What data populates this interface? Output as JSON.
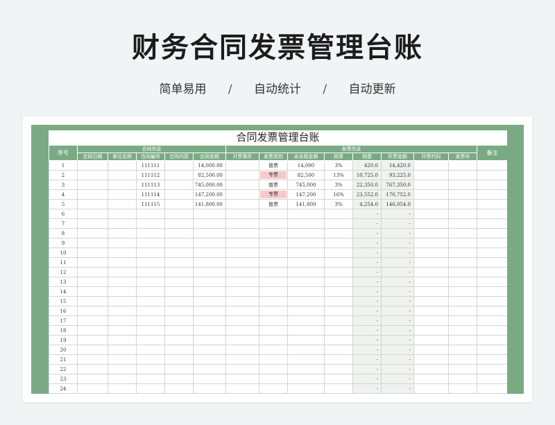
{
  "page": {
    "title": "财务合同发票管理台账",
    "tags": [
      "简单易用",
      "自动统计",
      "自动更新"
    ],
    "separator": "/"
  },
  "sheet": {
    "title": "合同发票管理台账",
    "headers": {
      "index": "序号",
      "contract_group": "合同信息",
      "invoice_group": "发票信息",
      "remark": "备注",
      "contract_cols": [
        "合同日期",
        "单位名称",
        "合同编号",
        "合同内容",
        "合同金额"
      ],
      "invoice_cols": [
        "开票事件",
        "发票类别",
        "未含税金额",
        "税率",
        "税费",
        "开票金额",
        "开票代码",
        "发票号"
      ]
    },
    "rows": [
      {
        "index": "1",
        "contract_no": "111111",
        "contract_amount": "14,000.00",
        "invoice_type": "普票",
        "untaxed": "14,000",
        "rate": "3%",
        "tax": "420.0",
        "invoice_amount": "14,420.0"
      },
      {
        "index": "2",
        "contract_no": "111112",
        "contract_amount": "82,500.00",
        "invoice_type": "专票",
        "untaxed": "82,500",
        "rate": "13%",
        "tax": "10,725.0",
        "invoice_amount": "93,225.0"
      },
      {
        "index": "3",
        "contract_no": "111113",
        "contract_amount": "745,000.00",
        "invoice_type": "普票",
        "untaxed": "745,000",
        "rate": "3%",
        "tax": "22,350.0",
        "invoice_amount": "767,350.0"
      },
      {
        "index": "4",
        "contract_no": "111114",
        "contract_amount": "147,200.00",
        "invoice_type": "专票",
        "untaxed": "147,200",
        "rate": "16%",
        "tax": "23,552.0",
        "invoice_amount": "170,752.0"
      },
      {
        "index": "5",
        "contract_no": "111115",
        "contract_amount": "141,800.00",
        "invoice_type": "普票",
        "untaxed": "141,800",
        "rate": "3%",
        "tax": "4,254.0",
        "invoice_amount": "146,054.0"
      }
    ],
    "empty_row_indices": [
      "6",
      "7",
      "8",
      "9",
      "10",
      "11",
      "12",
      "13",
      "14",
      "15",
      "16",
      "17",
      "18",
      "19",
      "20",
      "21",
      "22",
      "23",
      "24"
    ],
    "empty_placeholder": "-",
    "highlight_color": "#f6c9cc",
    "accent_color": "#7aaa84"
  }
}
